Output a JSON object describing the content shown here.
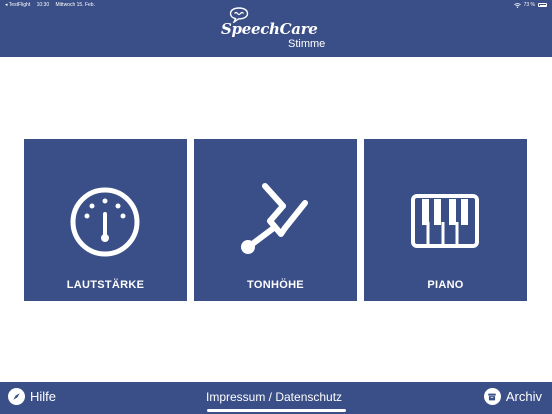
{
  "status_bar": {
    "carrier": "◂ TestFlight",
    "time": "10:30",
    "date": "Mittwoch 15. Feb.",
    "battery": "73 %",
    "wifi_icon": "wifi-icon",
    "battery_icon": "battery-icon"
  },
  "header": {
    "app_name": "SpeechCare",
    "subtitle": "Stimme",
    "logo_icon": "speech-bubble-icon"
  },
  "tiles": [
    {
      "label": "LAUTSTÄRKE",
      "icon": "gauge-icon"
    },
    {
      "label": "TONHÖHE",
      "icon": "tuning-fork-icon"
    },
    {
      "label": "PIANO",
      "icon": "piano-keys-icon"
    }
  ],
  "footer": {
    "help_label": "Hilfe",
    "help_icon": "compass-icon",
    "legal_label": "Impressum / Datenschutz",
    "archive_label": "Archiv",
    "archive_icon": "archive-box-icon"
  },
  "colors": {
    "brand_blue": "#3a4e87",
    "text_light": "#ffffff"
  }
}
